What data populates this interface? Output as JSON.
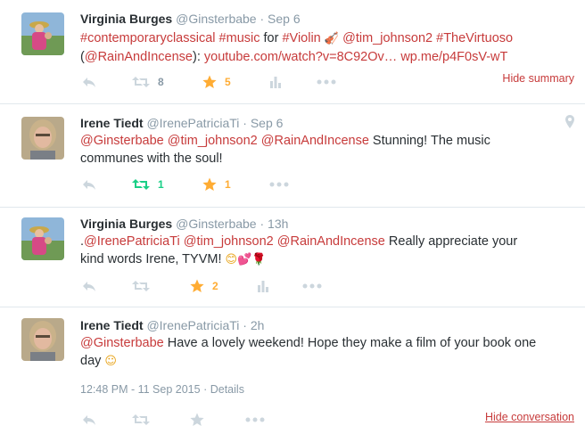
{
  "tweets": [
    {
      "fullname": "Virginia Burges",
      "handle": "@Ginsterbabe",
      "sep": "·",
      "time": "Sep 6",
      "line1": [
        {
          "t": "#contemporaryclassical",
          "link": true
        },
        {
          "t": " ",
          "link": false
        },
        {
          "t": "#music",
          "link": true
        },
        {
          "t": " for ",
          "link": false
        },
        {
          "t": "#Violin",
          "link": true
        }
      ],
      "line1_tail": [
        {
          "t": " ",
          "link": false
        },
        {
          "t": "@tim_johnson2",
          "link": true
        },
        {
          "t": " ",
          "link": false
        },
        {
          "t": "#TheVirtuoso",
          "link": true
        }
      ],
      "line2": [
        {
          "t": "(",
          "link": false
        },
        {
          "t": "@RainAndIncense",
          "link": true
        },
        {
          "t": "): ",
          "link": false
        },
        {
          "t": "youtube.com/watch?v=8C92Ov…",
          "link": true
        },
        {
          "t": " ",
          "link": false
        },
        {
          "t": "wp.me/p4F0sV-wT",
          "link": true
        }
      ],
      "retweets": "8",
      "favorites": "5",
      "right_link": "Hide summary"
    },
    {
      "fullname": "Irene Tiedt",
      "handle": "@IrenePatriciaTi",
      "sep": "·",
      "time": "Sep 6",
      "line1": [
        {
          "t": "@Ginsterbabe",
          "link": true
        },
        {
          "t": " ",
          "link": false
        },
        {
          "t": "@tim_johnson2",
          "link": true
        },
        {
          "t": " ",
          "link": false
        },
        {
          "t": "@RainAndIncense",
          "link": true
        },
        {
          "t": " Stunning! The music",
          "link": false
        }
      ],
      "line2": [
        {
          "t": "communes with the soul!",
          "link": false
        }
      ],
      "retweets": "1",
      "favorites": "1"
    },
    {
      "fullname": "Virginia Burges",
      "handle": "@Ginsterbabe",
      "sep": "·",
      "time": "13h",
      "line1": [
        {
          "t": ".",
          "link": false
        },
        {
          "t": "@IrenePatriciaTi",
          "link": true
        },
        {
          "t": " ",
          "link": false
        },
        {
          "t": "@tim_johnson2",
          "link": true
        },
        {
          "t": " ",
          "link": false
        },
        {
          "t": "@RainAndIncense",
          "link": true
        },
        {
          "t": " Really appreciate your",
          "link": false
        }
      ],
      "line2": [
        {
          "t": "kind words Irene, TYVM! ",
          "link": false
        }
      ],
      "favorites": "2"
    },
    {
      "fullname": "Irene Tiedt",
      "handle": "@IrenePatriciaTi",
      "sep": "·",
      "time": "2h",
      "line1": [
        {
          "t": "@Ginsterbabe",
          "link": true
        },
        {
          "t": " Have a lovely weekend! Hope they make a film of your book one",
          "link": false
        }
      ],
      "line2": [
        {
          "t": "day ",
          "link": false
        }
      ],
      "timestamp": "12:48 PM - 11 Sep 2015",
      "details_sep": "·",
      "details": "Details",
      "right_link": "Hide conversation"
    }
  ],
  "colors": {
    "link": "#c73b3b",
    "muted": "#8899a6",
    "retweet_active": "#19cf86",
    "favorite": "#ffac33"
  }
}
